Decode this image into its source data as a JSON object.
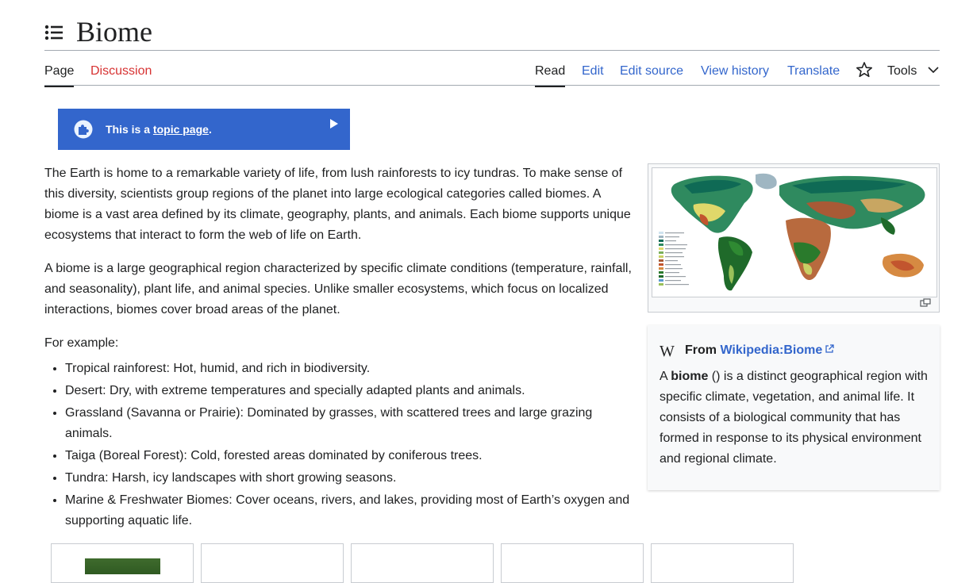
{
  "page": {
    "title": "Biome"
  },
  "tabs": {
    "page": "Page",
    "discussion": "Discussion",
    "read": "Read",
    "edit": "Edit",
    "edit_source": "Edit source",
    "view_history": "View history",
    "translate": "Translate",
    "tools": "Tools"
  },
  "banner": {
    "prefix": "This is a ",
    "link": "topic page",
    "suffix": ".",
    "background": "#3366cc"
  },
  "intro": {
    "p1": "The Earth is home to a remarkable variety of life, from lush rainforests to icy tundras. To make sense of this diversity, scientists group regions of the planet into large ecological categories called biomes. A biome is a vast area defined by its climate, geography, plants, and animals. Each biome supports unique ecosystems that interact to form the web of life on Earth.",
    "p2": "A biome is a large geographical region characterized by specific climate conditions (temperature, rainfall, and seasonality), plant life, and animal species. Unlike smaller ecosystems, which focus on localized interactions, biomes cover broad areas of the planet.",
    "example_label": "For example:"
  },
  "examples": [
    "Tropical rainforest: Hot, humid, and rich in biodiversity.",
    "Desert: Dry, with extreme temperatures and specially adapted plants and animals.",
    "Grassland (Savanna or Prairie): Dominated by grasses, with scattered trees and large grazing animals.",
    "Taiga (Boreal Forest): Cold, forested areas dominated by coniferous trees.",
    "Tundra: Harsh, icy landscapes with short growing seasons.",
    "Marine & Freshwater Biomes: Cover oceans, rivers, and lakes, providing most of Earth’s oxygen and supporting aquatic life."
  ],
  "wiki_card": {
    "from_label": "From",
    "source_link": "Wikipedia:Biome",
    "text_prefix": "A ",
    "text_bold": "biome",
    "text_rest": " () is a distinct geographical region with specific climate, vegetation, and animal life. It consists of a biological community that has formed in response to its physical environment and regional climate."
  },
  "icons": {
    "toc": "list-icon",
    "watch": "star-icon",
    "tools": "chevron-down-icon",
    "banner": "puzzle-icon",
    "banner_toggle": "play-icon",
    "map_expand": "expand-icon",
    "wiki": "wikipedia-logo-icon",
    "external": "external-link-icon"
  },
  "colors": {
    "link": "#3366cc",
    "red_link": "#d73333",
    "text": "#202122"
  }
}
